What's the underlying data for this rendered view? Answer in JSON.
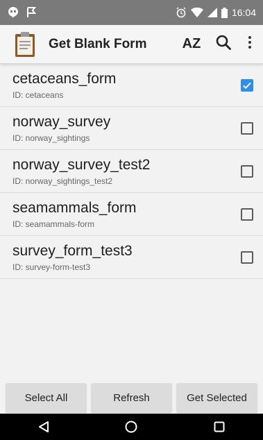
{
  "status_bar": {
    "time": "16:04"
  },
  "action_bar": {
    "title": "Get Blank Form",
    "sort_label": "AZ"
  },
  "forms": [
    {
      "name": "cetaceans_form",
      "id": "ID: cetaceans",
      "checked": true
    },
    {
      "name": "norway_survey",
      "id": "ID: norway_sightings",
      "checked": false
    },
    {
      "name": "norway_survey_test2",
      "id": "ID: norway_sightings_test2",
      "checked": false
    },
    {
      "name": "seamammals_form",
      "id": "ID: seamammals-form",
      "checked": false
    },
    {
      "name": "survey_form_test3",
      "id": "ID: survey-form-test3",
      "checked": false
    }
  ],
  "buttons": {
    "select_all": "Select All",
    "refresh": "Refresh",
    "get_selected": "Get Selected"
  },
  "colors": {
    "accent": "#2f8fe8",
    "status_bar": "#7a7a7a",
    "nav_bar": "#000000"
  },
  "icons": {
    "app": "clipboard-icon",
    "sort": "sort-az-icon",
    "search": "search-icon",
    "overflow": "overflow-menu-icon"
  }
}
